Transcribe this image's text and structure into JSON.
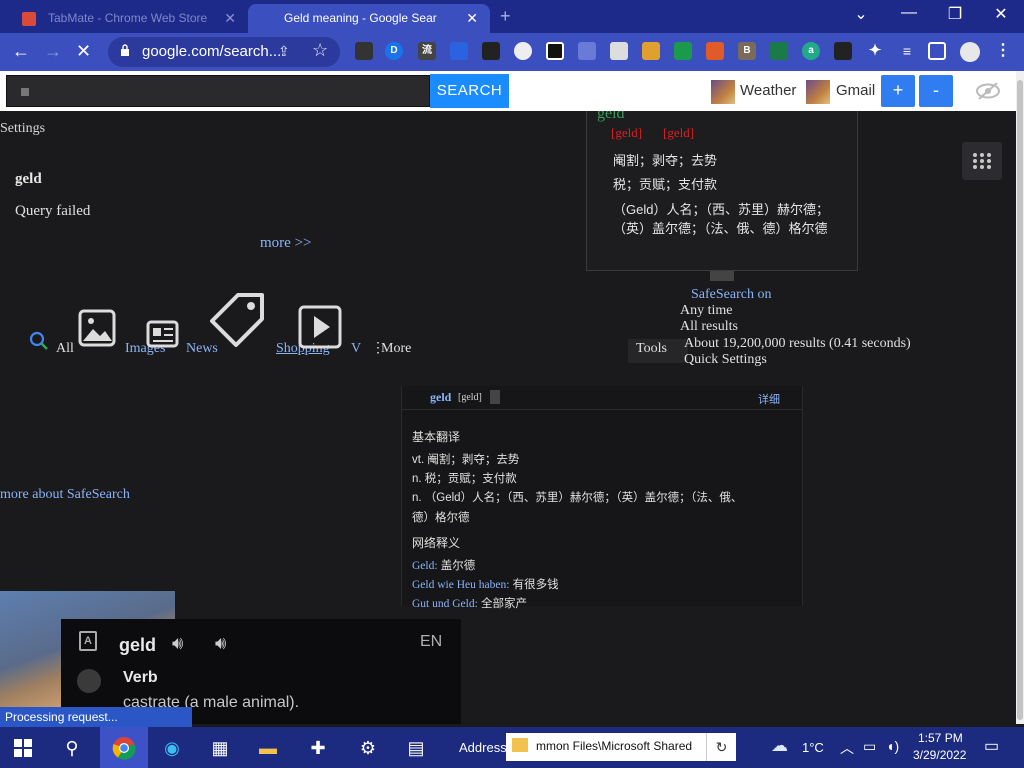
{
  "browser": {
    "tabs": [
      {
        "title": "TabMate - Chrome Web Store",
        "active": false
      },
      {
        "title": "Geld meaning - Google Sear",
        "active": true
      }
    ],
    "new_tab_symbol": "+",
    "url": "google.com/search...",
    "window_controls": {
      "chevron": "⌄",
      "minimize": "—",
      "restore": "❐",
      "close": "✕"
    }
  },
  "extension_bar": {
    "search_placeholder": "",
    "search_button": "SEARCH",
    "links": [
      "Weather",
      "Gmail"
    ],
    "plus_label": "+",
    "minus_label": "-",
    "colors": {
      "search_button": "#1a8cff",
      "pm_button": "#2f7df0"
    }
  },
  "page": {
    "settings_link": "Settings",
    "keyword": "geld",
    "query_failed": "Query failed",
    "more_link": "more >>",
    "more_about_safesearch": "more about SafeSearch"
  },
  "dict_popup": {
    "word": "geld",
    "phonetics": [
      "[geld]",
      "[geld]"
    ],
    "lines": [
      "阉割；剥夺；去势",
      "税；贡赋；支付款",
      "（Geld）人名；（西、苏里）赫尔德；（英）盖尔德；（法、俄、德）格尔德"
    ]
  },
  "search_nav": {
    "all": "All",
    "images": "Images",
    "news": "News",
    "shopping": "Shopping",
    "videos": "V",
    "more": "More",
    "tools": "Tools"
  },
  "tools_menu": {
    "safesearch": "SafeSearch on",
    "any_time": "Any time",
    "all_results": "All results",
    "stats": "About 19,200,000 results (0.41 seconds)",
    "quick_settings": "Quick Settings"
  },
  "dict_panel": {
    "word": "geld",
    "phonetic": "[geld]",
    "detail_link": "详细",
    "basic_heading": "基本翻译",
    "basic": [
      "vt. 阉割；剥夺；去势",
      "n. 税；贡赋；支付款",
      "n. （Geld）人名；（西、苏里）赫尔德；（英）盖尔德；（法、俄、",
      "德）格尔德"
    ],
    "web_heading": "网络释义",
    "web": [
      {
        "term": "Geld:",
        "meaning": "盖尔德"
      },
      {
        "term": "Geld wie Heu haben:",
        "meaning": "有很多钱"
      },
      {
        "term": "Gut und Geld:",
        "meaning": "全部家产"
      }
    ]
  },
  "pronounce_bubble": {
    "word": "geld",
    "lang": "EN",
    "pos": "Verb",
    "definition": "castrate (a male animal)."
  },
  "status_text": "Processing request...",
  "taskbar": {
    "address_label": "Address",
    "address_value": "mmon Files\\Microsoft Shared",
    "temperature": "1°C",
    "time": "1:57 PM",
    "date": "3/29/2022"
  }
}
